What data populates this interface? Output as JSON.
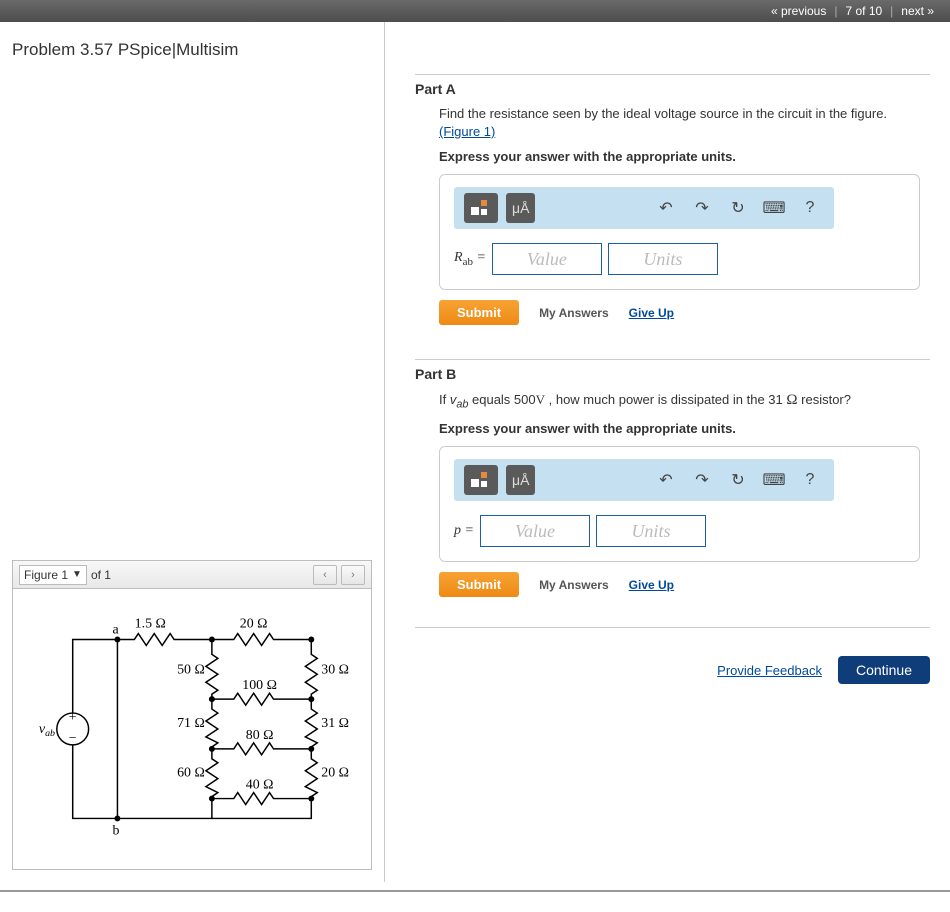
{
  "topnav": {
    "prev": "« previous",
    "counter": "7 of 10",
    "next": "next »"
  },
  "problem": {
    "title": "Problem 3.57 PSpice|Multisim"
  },
  "figure": {
    "selector_label": "Figure 1",
    "of_text": "of 1",
    "prev": "‹",
    "next": "›",
    "circuit": {
      "source_label": "v_ab",
      "node_a": "a",
      "node_b": "b",
      "r_top_left": "1.5 Ω",
      "r_top_right": "20 Ω",
      "r_50": "50 Ω",
      "r_30": "30 Ω",
      "r_100": "100 Ω",
      "r_71": "71 Ω",
      "r_31": "31 Ω",
      "r_80": "80 Ω",
      "r_60": "60 Ω",
      "r_20": "20 Ω",
      "r_40": "40 Ω"
    }
  },
  "partA": {
    "label": "Part A",
    "instruction": "Find the resistance seen by the ideal voltage source in the circuit in the figure.",
    "figure_link": "(Figure 1)",
    "express": "Express your answer with the appropriate units.",
    "var_html": "R",
    "var_sub": "ab",
    "equals": " = ",
    "value_placeholder": "Value",
    "units_placeholder": "Units",
    "submit": "Submit",
    "my_answers": "My Answers",
    "give_up": "Give Up"
  },
  "partB": {
    "label": "Part B",
    "instruction_pre": "If ",
    "instruction_var": "v",
    "instruction_sub": "ab",
    "instruction_mid": " equals 500",
    "instruction_unit": "V",
    "instruction_post": " , how much power is dissipated in the 31 ",
    "instruction_ohm": "Ω",
    "instruction_end": " resistor?",
    "express": "Express your answer with the appropriate units.",
    "var_html": "p",
    "equals": " = ",
    "value_placeholder": "Value",
    "units_placeholder": "Units",
    "submit": "Submit",
    "my_answers": "My Answers",
    "give_up": "Give Up"
  },
  "toolbar": {
    "units_label": "μÅ",
    "undo": "↶",
    "redo": "↷",
    "reset": "↻",
    "keyboard": "⌨",
    "help": "?"
  },
  "footer": {
    "feedback": "Provide Feedback",
    "continue": "Continue"
  }
}
